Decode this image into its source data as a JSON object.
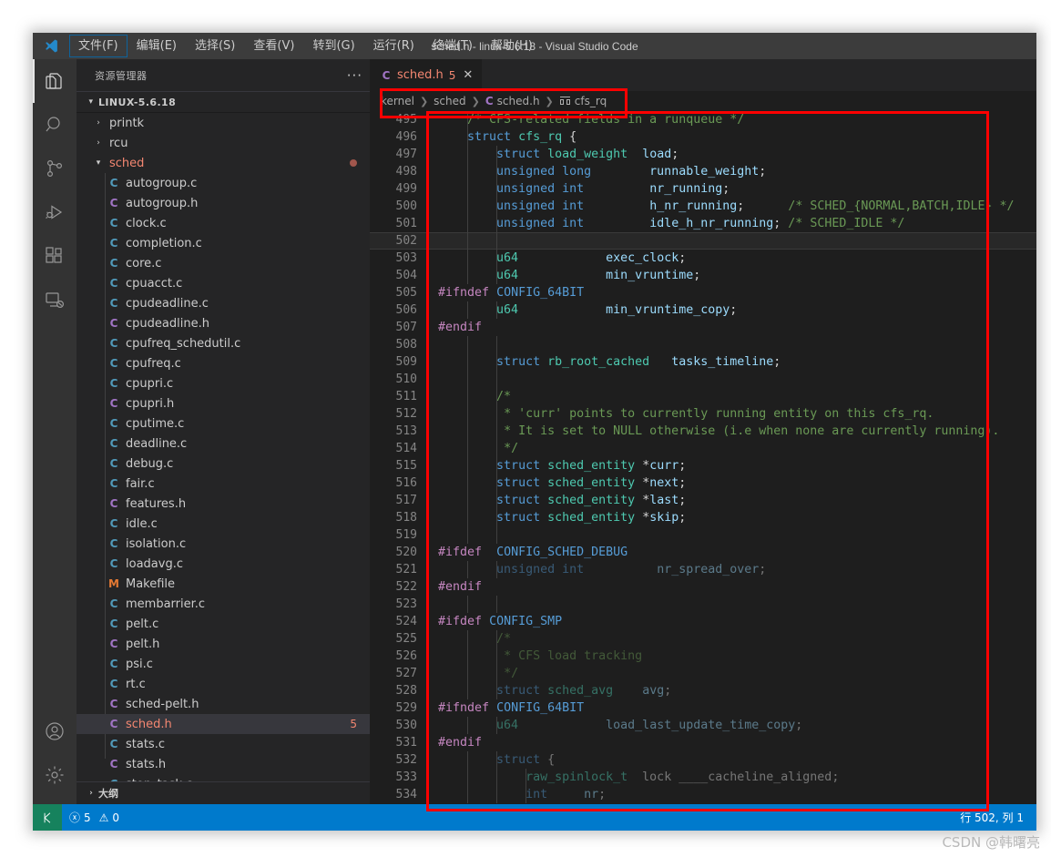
{
  "window": {
    "title": "sched.h - linux-5.6.18 - Visual Studio Code"
  },
  "menu": {
    "items": [
      {
        "label": "文件(F)",
        "active": true
      },
      {
        "label": "编辑(E)",
        "active": false
      },
      {
        "label": "选择(S)",
        "active": false
      },
      {
        "label": "查看(V)",
        "active": false
      },
      {
        "label": "转到(G)",
        "active": false
      },
      {
        "label": "运行(R)",
        "active": false
      },
      {
        "label": "终端(T)",
        "active": false
      },
      {
        "label": "帮助(H)",
        "active": false
      }
    ]
  },
  "activity_bar": {
    "items": [
      {
        "name": "explorer-icon",
        "selected": true
      },
      {
        "name": "search-icon",
        "selected": false
      },
      {
        "name": "source-control-icon",
        "selected": false
      },
      {
        "name": "run-debug-icon",
        "selected": false
      },
      {
        "name": "extensions-icon",
        "selected": false
      },
      {
        "name": "remote-explorer-icon",
        "selected": false
      }
    ],
    "bottom_items": [
      {
        "name": "account-icon"
      },
      {
        "name": "settings-gear-icon"
      }
    ]
  },
  "sidebar": {
    "header": "资源管理器",
    "more_actions": "···",
    "root_folder": "LINUX-5.6.18",
    "outline_label": "大纲",
    "tree": [
      {
        "label": "printk",
        "kind": "folder",
        "depth": 1,
        "expanded": false
      },
      {
        "label": "rcu",
        "kind": "folder",
        "depth": 1,
        "expanded": false
      },
      {
        "label": "sched",
        "kind": "folder",
        "depth": 1,
        "expanded": true,
        "modified": true
      },
      {
        "label": "autogroup.c",
        "kind": "c",
        "depth": 2
      },
      {
        "label": "autogroup.h",
        "kind": "h",
        "depth": 2
      },
      {
        "label": "clock.c",
        "kind": "c",
        "depth": 2
      },
      {
        "label": "completion.c",
        "kind": "c",
        "depth": 2
      },
      {
        "label": "core.c",
        "kind": "c",
        "depth": 2
      },
      {
        "label": "cpuacct.c",
        "kind": "c",
        "depth": 2
      },
      {
        "label": "cpudeadline.c",
        "kind": "c",
        "depth": 2
      },
      {
        "label": "cpudeadline.h",
        "kind": "h",
        "depth": 2
      },
      {
        "label": "cpufreq_schedutil.c",
        "kind": "c",
        "depth": 2
      },
      {
        "label": "cpufreq.c",
        "kind": "c",
        "depth": 2
      },
      {
        "label": "cpupri.c",
        "kind": "c",
        "depth": 2
      },
      {
        "label": "cpupri.h",
        "kind": "h",
        "depth": 2
      },
      {
        "label": "cputime.c",
        "kind": "c",
        "depth": 2
      },
      {
        "label": "deadline.c",
        "kind": "c",
        "depth": 2
      },
      {
        "label": "debug.c",
        "kind": "c",
        "depth": 2
      },
      {
        "label": "fair.c",
        "kind": "c",
        "depth": 2
      },
      {
        "label": "features.h",
        "kind": "h",
        "depth": 2
      },
      {
        "label": "idle.c",
        "kind": "c",
        "depth": 2
      },
      {
        "label": "isolation.c",
        "kind": "c",
        "depth": 2
      },
      {
        "label": "loadavg.c",
        "kind": "c",
        "depth": 2
      },
      {
        "label": "Makefile",
        "kind": "mk",
        "depth": 2
      },
      {
        "label": "membarrier.c",
        "kind": "c",
        "depth": 2
      },
      {
        "label": "pelt.c",
        "kind": "c",
        "depth": 2
      },
      {
        "label": "pelt.h",
        "kind": "h",
        "depth": 2
      },
      {
        "label": "psi.c",
        "kind": "c",
        "depth": 2
      },
      {
        "label": "rt.c",
        "kind": "c",
        "depth": 2
      },
      {
        "label": "sched-pelt.h",
        "kind": "h",
        "depth": 2
      },
      {
        "label": "sched.h",
        "kind": "h",
        "depth": 2,
        "selected": true,
        "error": true,
        "badge": "5"
      },
      {
        "label": "stats.c",
        "kind": "c",
        "depth": 2
      },
      {
        "label": "stats.h",
        "kind": "h",
        "depth": 2
      },
      {
        "label": "stop_task.c",
        "kind": "c",
        "depth": 2
      }
    ]
  },
  "editor": {
    "tab": {
      "icon_kind": "h",
      "label": "sched.h",
      "badge": "5",
      "close": "✕"
    },
    "breadcrumb": [
      {
        "label": "kernel",
        "icon": null
      },
      {
        "label": "sched",
        "icon": null
      },
      {
        "label": "sched.h",
        "icon": "c-file-icon"
      },
      {
        "label": "cfs_rq",
        "icon": "struct-symbol-icon"
      }
    ],
    "first_line": 495,
    "current_line": 502,
    "lines": [
      {
        "n": 495,
        "tokens": [
          {
            "t": "    ",
            "c": "pl"
          },
          {
            "t": "/* CFS-related fields in a runqueue */",
            "c": "cm"
          }
        ]
      },
      {
        "n": 496,
        "tokens": [
          {
            "t": "    ",
            "c": "pl"
          },
          {
            "t": "struct",
            "c": "kw"
          },
          {
            "t": " ",
            "c": "pl"
          },
          {
            "t": "cfs_rq",
            "c": "ty"
          },
          {
            "t": " {",
            "c": "pl"
          }
        ]
      },
      {
        "n": 497,
        "tokens": [
          {
            "t": "        ",
            "c": "pl"
          },
          {
            "t": "struct",
            "c": "kw"
          },
          {
            "t": " ",
            "c": "pl"
          },
          {
            "t": "load_weight",
            "c": "ty"
          },
          {
            "t": "  ",
            "c": "pl"
          },
          {
            "t": "load",
            "c": "id"
          },
          {
            "t": ";",
            "c": "pl"
          }
        ]
      },
      {
        "n": 498,
        "tokens": [
          {
            "t": "        ",
            "c": "pl"
          },
          {
            "t": "unsigned long",
            "c": "kw"
          },
          {
            "t": "        ",
            "c": "pl"
          },
          {
            "t": "runnable_weight",
            "c": "id"
          },
          {
            "t": ";",
            "c": "pl"
          }
        ]
      },
      {
        "n": 499,
        "tokens": [
          {
            "t": "        ",
            "c": "pl"
          },
          {
            "t": "unsigned int",
            "c": "kw"
          },
          {
            "t": "         ",
            "c": "pl"
          },
          {
            "t": "nr_running",
            "c": "id"
          },
          {
            "t": ";",
            "c": "pl"
          }
        ]
      },
      {
        "n": 500,
        "tokens": [
          {
            "t": "        ",
            "c": "pl"
          },
          {
            "t": "unsigned int",
            "c": "kw"
          },
          {
            "t": "         ",
            "c": "pl"
          },
          {
            "t": "h_nr_running",
            "c": "id"
          },
          {
            "t": ";",
            "c": "pl"
          },
          {
            "t": "      ",
            "c": "pl"
          },
          {
            "t": "/* SCHED_{NORMAL,BATCH,IDLE} */",
            "c": "cm"
          }
        ]
      },
      {
        "n": 501,
        "tokens": [
          {
            "t": "        ",
            "c": "pl"
          },
          {
            "t": "unsigned int",
            "c": "kw"
          },
          {
            "t": "         ",
            "c": "pl"
          },
          {
            "t": "idle_h_nr_running",
            "c": "id"
          },
          {
            "t": "; ",
            "c": "pl"
          },
          {
            "t": "/* SCHED_IDLE */",
            "c": "cm"
          }
        ]
      },
      {
        "n": 502,
        "tokens": [],
        "current": true
      },
      {
        "n": 503,
        "tokens": [
          {
            "t": "        ",
            "c": "pl"
          },
          {
            "t": "u64",
            "c": "ty"
          },
          {
            "t": "            ",
            "c": "pl"
          },
          {
            "t": "exec_clock",
            "c": "id"
          },
          {
            "t": ";",
            "c": "pl"
          }
        ]
      },
      {
        "n": 504,
        "tokens": [
          {
            "t": "        ",
            "c": "pl"
          },
          {
            "t": "u64",
            "c": "ty"
          },
          {
            "t": "            ",
            "c": "pl"
          },
          {
            "t": "min_vruntime",
            "c": "id"
          },
          {
            "t": ";",
            "c": "pl"
          }
        ]
      },
      {
        "n": 505,
        "tokens": [
          {
            "t": "#ifndef",
            "c": "pp"
          },
          {
            "t": " ",
            "c": "pl"
          },
          {
            "t": "CONFIG_64BIT",
            "c": "mc"
          }
        ]
      },
      {
        "n": 506,
        "tokens": [
          {
            "t": "        ",
            "c": "pl"
          },
          {
            "t": "u64",
            "c": "ty"
          },
          {
            "t": "            ",
            "c": "pl"
          },
          {
            "t": "min_vruntime_copy",
            "c": "id"
          },
          {
            "t": ";",
            "c": "pl"
          }
        ]
      },
      {
        "n": 507,
        "tokens": [
          {
            "t": "#endif",
            "c": "pp"
          }
        ]
      },
      {
        "n": 508,
        "tokens": []
      },
      {
        "n": 509,
        "tokens": [
          {
            "t": "        ",
            "c": "pl"
          },
          {
            "t": "struct",
            "c": "kw"
          },
          {
            "t": " ",
            "c": "pl"
          },
          {
            "t": "rb_root_cached",
            "c": "ty"
          },
          {
            "t": "   ",
            "c": "pl"
          },
          {
            "t": "tasks_timeline",
            "c": "id"
          },
          {
            "t": ";",
            "c": "pl"
          }
        ]
      },
      {
        "n": 510,
        "tokens": []
      },
      {
        "n": 511,
        "tokens": [
          {
            "t": "        ",
            "c": "pl"
          },
          {
            "t": "/*",
            "c": "cm"
          }
        ]
      },
      {
        "n": 512,
        "tokens": [
          {
            "t": "         ",
            "c": "pl"
          },
          {
            "t": "* 'curr' points to currently running entity on this cfs_rq.",
            "c": "cm"
          }
        ]
      },
      {
        "n": 513,
        "tokens": [
          {
            "t": "         ",
            "c": "pl"
          },
          {
            "t": "* It is set to NULL otherwise (i.e when none are currently running).",
            "c": "cm"
          }
        ]
      },
      {
        "n": 514,
        "tokens": [
          {
            "t": "         ",
            "c": "pl"
          },
          {
            "t": "*/",
            "c": "cm"
          }
        ]
      },
      {
        "n": 515,
        "tokens": [
          {
            "t": "        ",
            "c": "pl"
          },
          {
            "t": "struct",
            "c": "kw"
          },
          {
            "t": " ",
            "c": "pl"
          },
          {
            "t": "sched_entity",
            "c": "ty"
          },
          {
            "t": " *",
            "c": "pl"
          },
          {
            "t": "curr",
            "c": "id"
          },
          {
            "t": ";",
            "c": "pl"
          }
        ]
      },
      {
        "n": 516,
        "tokens": [
          {
            "t": "        ",
            "c": "pl"
          },
          {
            "t": "struct",
            "c": "kw"
          },
          {
            "t": " ",
            "c": "pl"
          },
          {
            "t": "sched_entity",
            "c": "ty"
          },
          {
            "t": " *",
            "c": "pl"
          },
          {
            "t": "next",
            "c": "id"
          },
          {
            "t": ";",
            "c": "pl"
          }
        ]
      },
      {
        "n": 517,
        "tokens": [
          {
            "t": "        ",
            "c": "pl"
          },
          {
            "t": "struct",
            "c": "kw"
          },
          {
            "t": " ",
            "c": "pl"
          },
          {
            "t": "sched_entity",
            "c": "ty"
          },
          {
            "t": " *",
            "c": "pl"
          },
          {
            "t": "last",
            "c": "id"
          },
          {
            "t": ";",
            "c": "pl"
          }
        ]
      },
      {
        "n": 518,
        "tokens": [
          {
            "t": "        ",
            "c": "pl"
          },
          {
            "t": "struct",
            "c": "kw"
          },
          {
            "t": " ",
            "c": "pl"
          },
          {
            "t": "sched_entity",
            "c": "ty"
          },
          {
            "t": " *",
            "c": "pl"
          },
          {
            "t": "skip",
            "c": "id"
          },
          {
            "t": ";",
            "c": "pl"
          }
        ]
      },
      {
        "n": 519,
        "tokens": []
      },
      {
        "n": 520,
        "tokens": [
          {
            "t": "#ifdef",
            "c": "pp"
          },
          {
            "t": "  ",
            "c": "pl"
          },
          {
            "t": "CONFIG_SCHED_DEBUG",
            "c": "mc"
          }
        ]
      },
      {
        "n": 521,
        "dim": true,
        "tokens": [
          {
            "t": "        ",
            "c": "pl"
          },
          {
            "t": "unsigned int",
            "c": "kw"
          },
          {
            "t": "          ",
            "c": "pl"
          },
          {
            "t": "nr_spread_over",
            "c": "id"
          },
          {
            "t": ";",
            "c": "pl"
          }
        ]
      },
      {
        "n": 522,
        "tokens": [
          {
            "t": "#endif",
            "c": "pp"
          }
        ]
      },
      {
        "n": 523,
        "tokens": []
      },
      {
        "n": 524,
        "tokens": [
          {
            "t": "#ifdef",
            "c": "pp"
          },
          {
            "t": " ",
            "c": "pl"
          },
          {
            "t": "CONFIG_SMP",
            "c": "mc"
          }
        ]
      },
      {
        "n": 525,
        "dim": true,
        "tokens": [
          {
            "t": "        ",
            "c": "pl"
          },
          {
            "t": "/*",
            "c": "cm"
          }
        ]
      },
      {
        "n": 526,
        "dim": true,
        "tokens": [
          {
            "t": "         ",
            "c": "pl"
          },
          {
            "t": "* CFS load tracking",
            "c": "cm"
          }
        ]
      },
      {
        "n": 527,
        "dim": true,
        "tokens": [
          {
            "t": "         ",
            "c": "pl"
          },
          {
            "t": "*/",
            "c": "cm"
          }
        ]
      },
      {
        "n": 528,
        "dim": true,
        "tokens": [
          {
            "t": "        ",
            "c": "pl"
          },
          {
            "t": "struct",
            "c": "kw"
          },
          {
            "t": " ",
            "c": "pl"
          },
          {
            "t": "sched_avg",
            "c": "ty"
          },
          {
            "t": "    ",
            "c": "pl"
          },
          {
            "t": "avg",
            "c": "id"
          },
          {
            "t": ";",
            "c": "pl"
          }
        ]
      },
      {
        "n": 529,
        "tokens": [
          {
            "t": "#ifndef",
            "c": "pp"
          },
          {
            "t": " ",
            "c": "pl"
          },
          {
            "t": "CONFIG_64BIT",
            "c": "mc"
          }
        ]
      },
      {
        "n": 530,
        "dim": true,
        "tokens": [
          {
            "t": "        ",
            "c": "pl"
          },
          {
            "t": "u64",
            "c": "ty"
          },
          {
            "t": "            ",
            "c": "pl"
          },
          {
            "t": "load_last_update_time_copy",
            "c": "id"
          },
          {
            "t": ";",
            "c": "pl"
          }
        ]
      },
      {
        "n": 531,
        "tokens": [
          {
            "t": "#endif",
            "c": "pp"
          }
        ]
      },
      {
        "n": 532,
        "dim": true,
        "tokens": [
          {
            "t": "        ",
            "c": "pl"
          },
          {
            "t": "struct",
            "c": "kw"
          },
          {
            "t": " {",
            "c": "pl"
          }
        ]
      },
      {
        "n": 533,
        "dim": true,
        "tokens": [
          {
            "t": "            ",
            "c": "pl"
          },
          {
            "t": "raw_spinlock_t",
            "c": "ty"
          },
          {
            "t": "  ",
            "c": "pl"
          },
          {
            "t": "lock ____cacheline_aligned",
            "c": "pl"
          },
          {
            "t": ";",
            "c": "pl"
          }
        ]
      },
      {
        "n": 534,
        "dim": true,
        "tokens": [
          {
            "t": "            ",
            "c": "pl"
          },
          {
            "t": "int",
            "c": "kw"
          },
          {
            "t": "     ",
            "c": "pl"
          },
          {
            "t": "nr",
            "c": "id"
          },
          {
            "t": ";",
            "c": "pl"
          }
        ]
      }
    ]
  },
  "status_bar": {
    "remote_icon": "remote-indicator-icon",
    "errors_icon": "error-circle-icon",
    "errors": "5",
    "warnings_icon": "warning-triangle-icon",
    "warnings": "0",
    "cursor_position": "行 502, 列 1"
  },
  "watermark": "CSDN @韩曙亮",
  "annotations": {
    "color": "#ff0000",
    "regions": [
      "breadcrumb-highlight",
      "code-body-highlight"
    ]
  }
}
